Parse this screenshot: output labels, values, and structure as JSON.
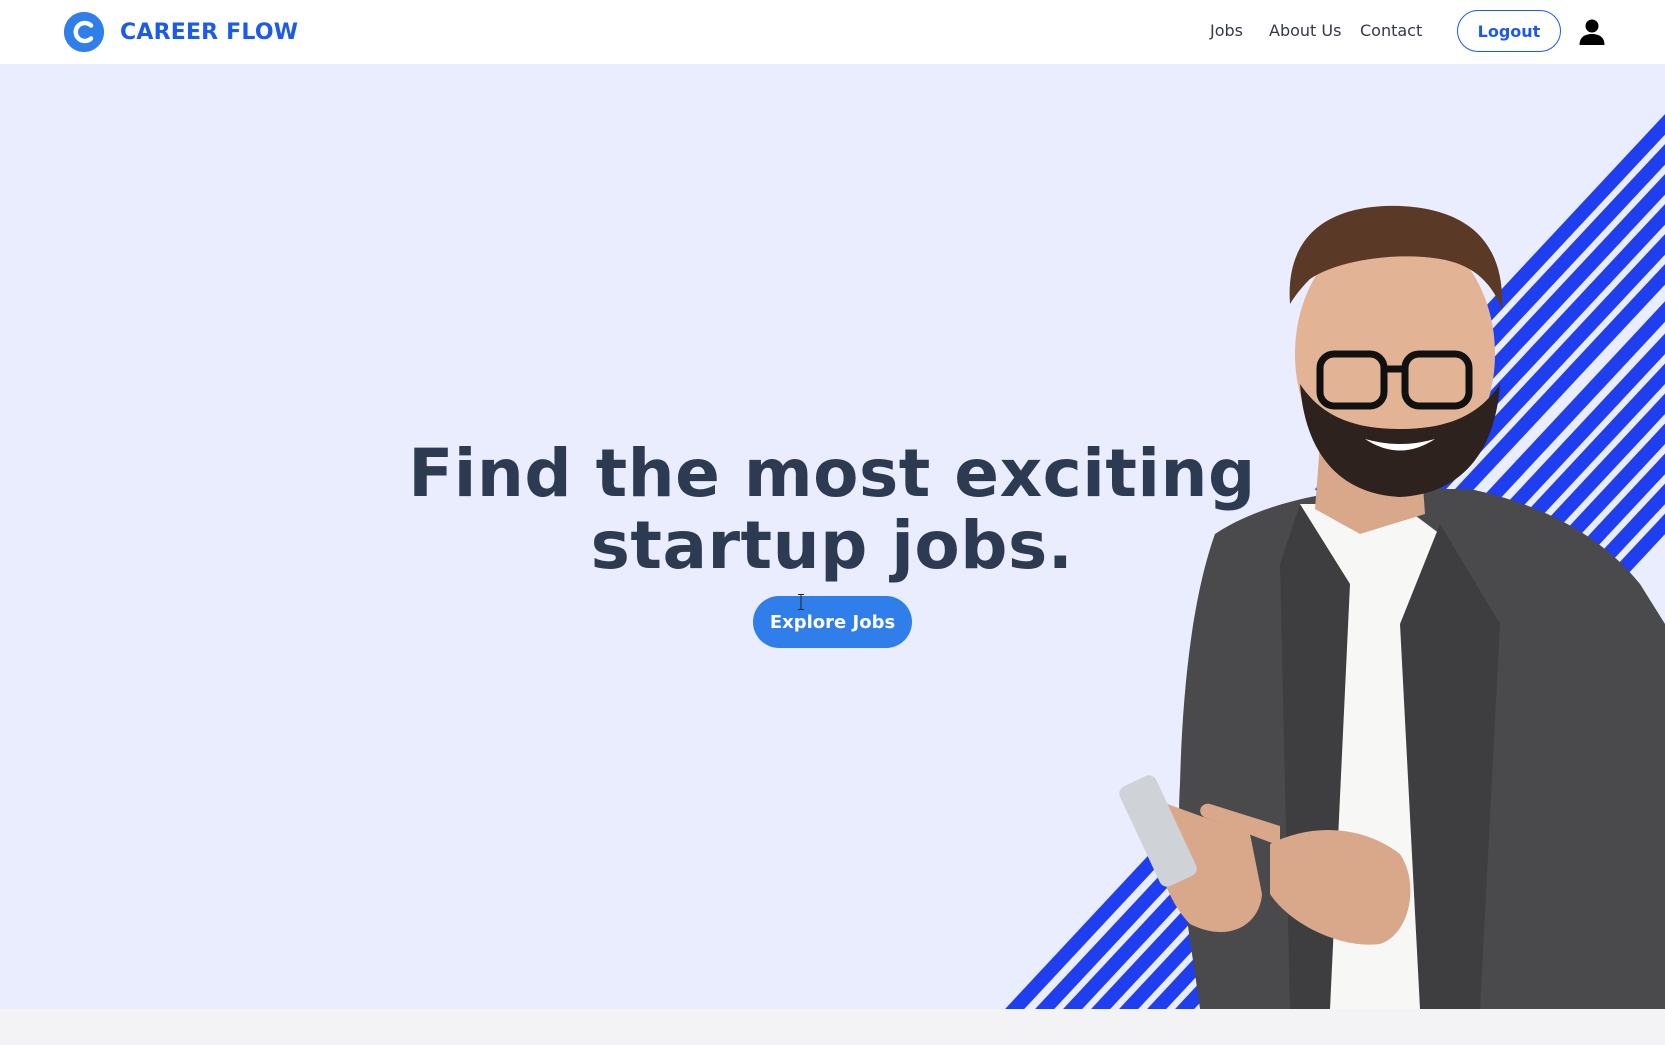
{
  "brand": {
    "name": "CAREER FLOW",
    "logo_icon": "career-flow-logo-icon",
    "color": "#1c5ae8"
  },
  "nav": {
    "links": [
      "Jobs",
      "About Us",
      "Contact"
    ],
    "logout_label": "Logout",
    "profile_icon": "user-icon"
  },
  "hero": {
    "title_line1": "Find the most exciting",
    "title_line2": "startup jobs.",
    "cta_label": "Explore Jobs",
    "background": "#e9edfe",
    "accent": "#2f7ee9",
    "stripe_color": "#1f3ef0"
  }
}
